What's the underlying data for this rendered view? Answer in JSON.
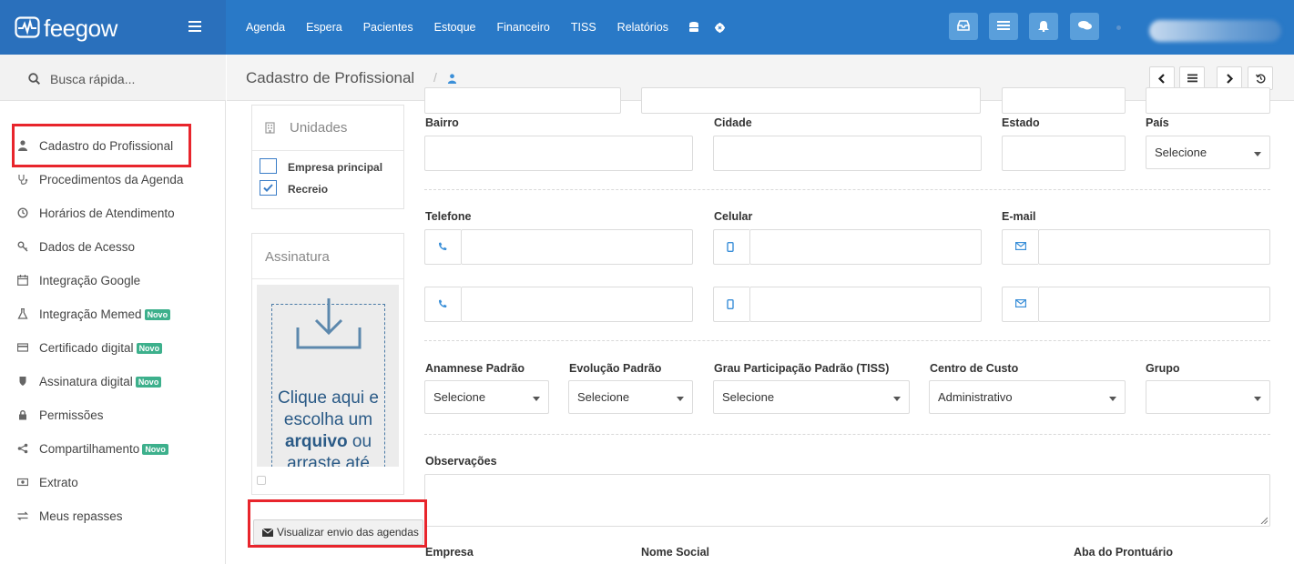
{
  "app": {
    "brand": "feegow"
  },
  "topnav": {
    "items": [
      "Agenda",
      "Espera",
      "Pacientes",
      "Estoque",
      "Financeiro",
      "TISS",
      "Relatórios"
    ],
    "icons": [
      "database-icon",
      "gear-icon"
    ]
  },
  "topbar_buttons": [
    "inbox-icon",
    "list-icon",
    "bell-icon",
    "chat-icon"
  ],
  "sidebar": {
    "search_label": "Busca rápida...",
    "items": [
      {
        "label": "Cadastro do Profissional",
        "icon": "user-md-icon",
        "badge": ""
      },
      {
        "label": "Procedimentos da Agenda",
        "icon": "stethoscope-icon",
        "badge": ""
      },
      {
        "label": "Horários de Atendimento",
        "icon": "clock-icon",
        "badge": ""
      },
      {
        "label": "Dados de Acesso",
        "icon": "key-icon",
        "badge": ""
      },
      {
        "label": "Integração Google",
        "icon": "calendar-icon",
        "badge": ""
      },
      {
        "label": "Integração Memed",
        "icon": "flask-icon",
        "badge": "Novo"
      },
      {
        "label": "Certificado digital",
        "icon": "credit-card-icon",
        "badge": "Novo"
      },
      {
        "label": "Assinatura digital",
        "icon": "shield-icon",
        "badge": "Novo"
      },
      {
        "label": "Permissões",
        "icon": "lock-icon",
        "badge": ""
      },
      {
        "label": "Compartilhamento",
        "icon": "share-icon",
        "badge": "Novo"
      },
      {
        "label": "Extrato",
        "icon": "money-icon",
        "badge": ""
      },
      {
        "label": "Meus repasses",
        "icon": "exchange-icon",
        "badge": ""
      }
    ]
  },
  "header": {
    "title": "Cadastro de Profissional",
    "separator": "/"
  },
  "units": {
    "title": "Unidades",
    "options": [
      {
        "label": "Empresa principal",
        "checked": false
      },
      {
        "label": "Recreio",
        "checked": true
      }
    ]
  },
  "signature": {
    "title": "Assinatura",
    "drop_line1": "Clique aqui e",
    "drop_line2": "escolha um",
    "drop_bold": "arquivo",
    "drop_line3": " ou",
    "drop_line4": "arraste até"
  },
  "send_button": "Visualizar envio das agendas",
  "form": {
    "bairro": "Bairro",
    "cidade": "Cidade",
    "estado": "Estado",
    "pais": "País",
    "pais_value": "Selecione",
    "telefone": "Telefone",
    "celular": "Celular",
    "email": "E-mail",
    "anamnese": "Anamnese Padrão",
    "anamnese_value": "Selecione",
    "evolucao": "Evolução Padrão",
    "evolucao_value": "Selecione",
    "grau": "Grau Participação Padrão (TISS)",
    "grau_value": "Selecione",
    "centro": "Centro de Custo",
    "centro_value": "Administrativo",
    "grupo": "Grupo",
    "grupo_value": "",
    "observacoes": "Observações",
    "empresa": "Empresa",
    "nome_social": "Nome Social",
    "aba": "Aba do Prontuário"
  },
  "colors": {
    "topbar": "#2979c7",
    "highlight": "#e8252c",
    "badge": "#3db08c"
  }
}
